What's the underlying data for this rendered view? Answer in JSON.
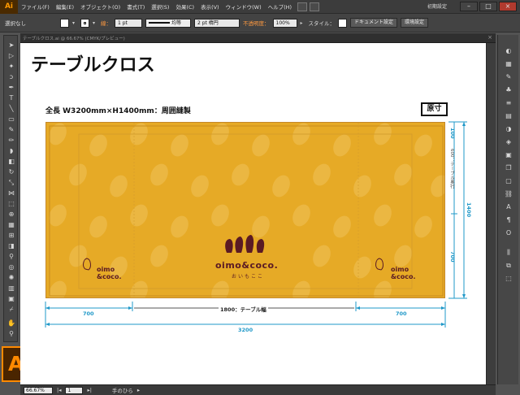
{
  "app": {
    "logo_text": "Ai",
    "badge_text": "Ai",
    "workspace_label": "初期設定",
    "window_buttons": {
      "minimize": "–",
      "maximize": "□",
      "close": "×"
    }
  },
  "menubar": {
    "items": [
      "ファイル(F)",
      "編集(E)",
      "オブジェクト(O)",
      "書式(T)",
      "選択(S)",
      "効果(C)",
      "表示(V)",
      "ウィンドウ(W)",
      "ヘルプ(H)"
    ]
  },
  "controlbar": {
    "selection_label": "選択なし",
    "stroke_label": "線：",
    "stroke_weight": "1 pt",
    "stroke_profile": "均等",
    "brush": "2 pt 楕円",
    "opacity_label": "不透明度：",
    "opacity_value": "100%",
    "style_label": "スタイル：",
    "document_setup_button": "ドキュメント設定",
    "preferences_button": "環境設定"
  },
  "document_tab": {
    "label": "テーブルクロス.ai @ 66.67% (CMYK/プレビュー)",
    "close": "×"
  },
  "artboard": {
    "title": "テーブルクロス",
    "spec": "全長 W3200mm×H1400mm：周囲縫製",
    "scale_badge": "原寸",
    "brand_small_line1": "oimo",
    "brand_small_line2": "&coco.",
    "brand_main": "oimo&coco.",
    "brand_sub": "おいもここ",
    "dimensions": {
      "left_width": "700",
      "center_width": "1800：テーブル幅",
      "right_width": "700",
      "total_width": "3200",
      "top_hem": "100",
      "table_drop": "600：テーブル奥行",
      "lower_drop": "700",
      "total_height": "1400"
    }
  },
  "statusbar": {
    "zoom": "66.67%",
    "page": "1",
    "tool_name": "手のひら"
  },
  "colors": {
    "cloth": "#e6aa26",
    "brand": "#5a1a24",
    "dimension_blue": "#1f98c8",
    "accent_orange": "#ff8a00"
  },
  "icons": {
    "tools": [
      "selection-icon",
      "direct-selection-icon",
      "magic-wand-icon",
      "lasso-icon",
      "pen-icon",
      "type-icon",
      "line-icon",
      "rectangle-icon",
      "paintbrush-icon",
      "pencil-icon",
      "blob-brush-icon",
      "eraser-icon",
      "rotate-icon",
      "scale-icon",
      "width-icon",
      "free-transform-icon",
      "shape-builder-icon",
      "perspective-icon",
      "mesh-icon",
      "gradient-icon",
      "eyedropper-icon",
      "blend-icon",
      "symbol-sprayer-icon",
      "graph-icon",
      "artboard-icon",
      "slice-icon",
      "hand-icon",
      "zoom-icon"
    ],
    "right_panel": [
      "color-icon",
      "swatches-icon",
      "brushes-icon",
      "symbols-icon",
      "stroke-icon",
      "gradient-panel-icon",
      "transparency-icon",
      "appearance-icon",
      "graphic-styles-icon",
      "layers-icon",
      "artboards-icon",
      "links-icon",
      "character-icon",
      "paragraph-icon",
      "opentype-icon",
      "align-icon",
      "pathfinder-icon",
      "transform-icon"
    ]
  }
}
